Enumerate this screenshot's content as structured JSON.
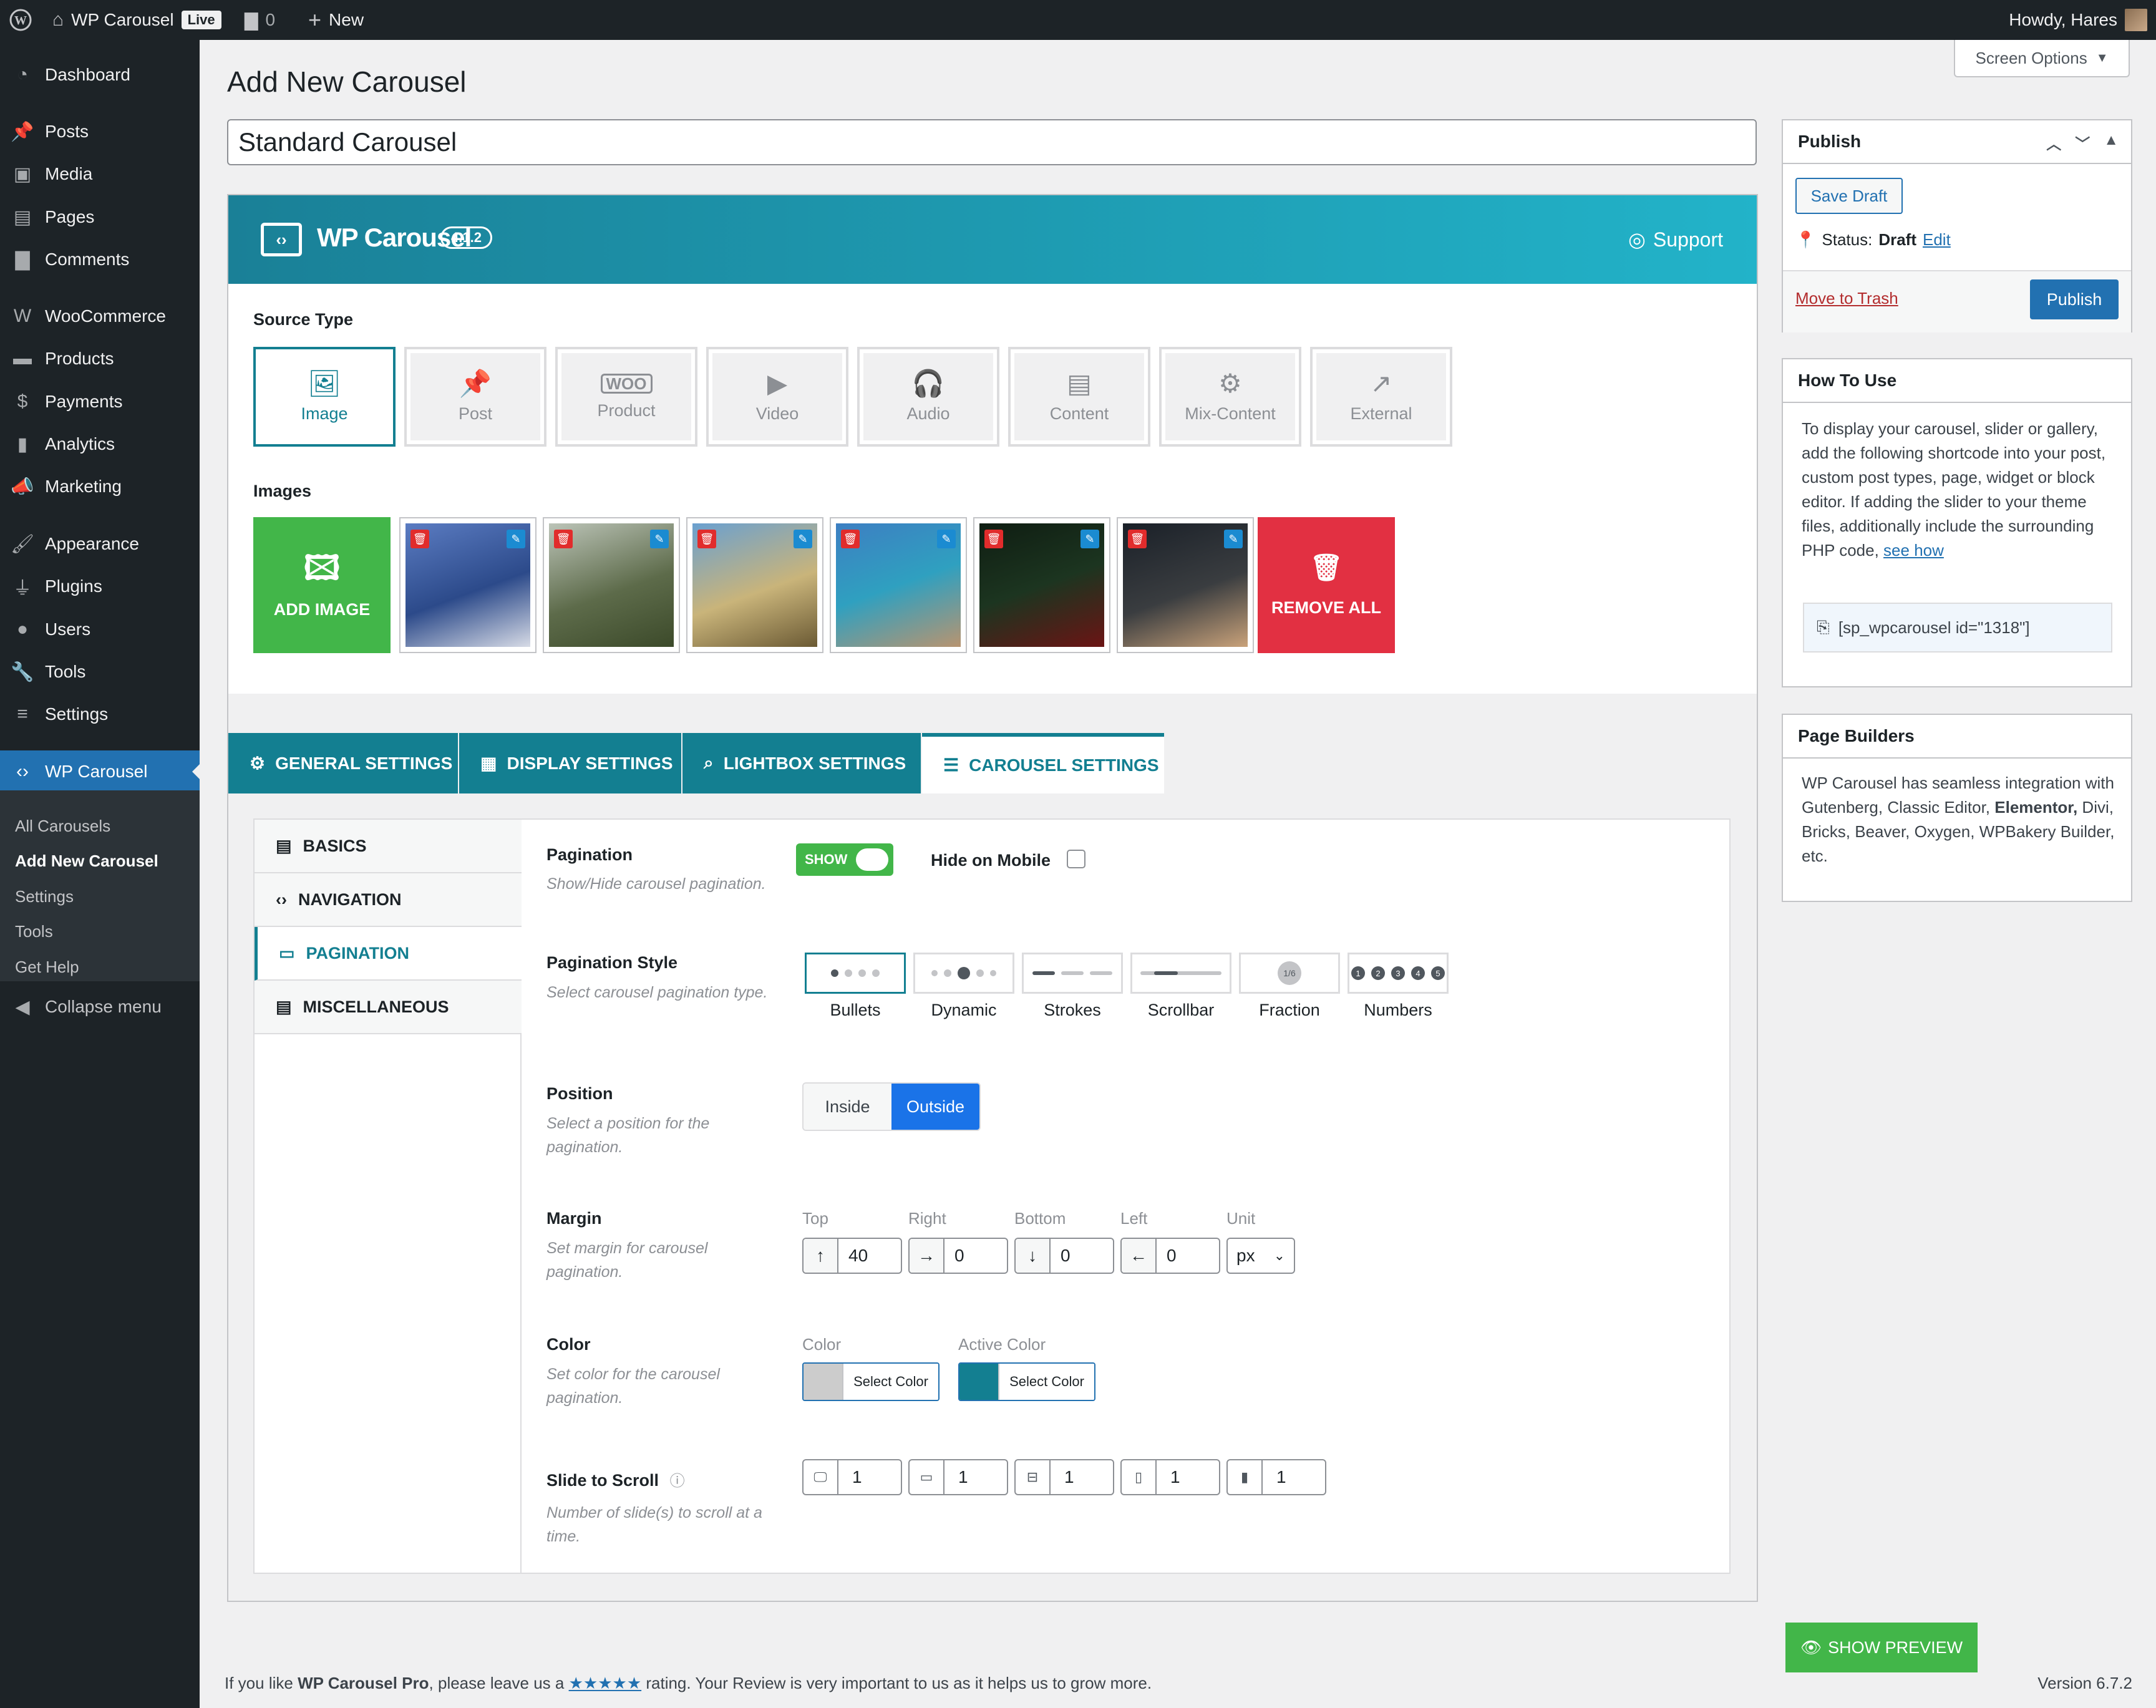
{
  "adminbar": {
    "site": "WP Carousel",
    "live": "Live",
    "comments": "0",
    "new": "New",
    "howdy": "Howdy, Hares"
  },
  "sidebar": {
    "items": [
      {
        "label": "Dashboard",
        "icon": "dashboard-icon"
      },
      {
        "label": "Posts",
        "icon": "pin-icon"
      },
      {
        "label": "Media",
        "icon": "media-icon"
      },
      {
        "label": "Pages",
        "icon": "pages-icon"
      },
      {
        "label": "Comments",
        "icon": "comment-icon"
      },
      {
        "label": "WooCommerce",
        "icon": "woo-icon"
      },
      {
        "label": "Products",
        "icon": "archive-icon"
      },
      {
        "label": "Payments",
        "icon": "dollar-icon"
      },
      {
        "label": "Analytics",
        "icon": "bar-chart-icon"
      },
      {
        "label": "Marketing",
        "icon": "megaphone-icon"
      },
      {
        "label": "Appearance",
        "icon": "brush-icon"
      },
      {
        "label": "Plugins",
        "icon": "plug-icon"
      },
      {
        "label": "Users",
        "icon": "user-icon"
      },
      {
        "label": "Tools",
        "icon": "wrench-icon"
      },
      {
        "label": "Settings",
        "icon": "sliders-icon"
      },
      {
        "label": "WP Carousel",
        "icon": "carousel-icon"
      }
    ],
    "submenu": [
      "All Carousels",
      "Add New Carousel",
      "Settings",
      "Tools",
      "Get Help"
    ],
    "collapse": "Collapse menu"
  },
  "page": {
    "title": "Add New Carousel",
    "screen_options": "Screen Options",
    "post_title": "Standard Carousel"
  },
  "plugin": {
    "name": "WP Carousel",
    "version": "4.1.2",
    "support": "Support"
  },
  "source": {
    "label": "Source Type",
    "types": [
      "Image",
      "Post",
      "Product",
      "Video",
      "Audio",
      "Content",
      "Mix-Content",
      "External"
    ],
    "selected": "Image"
  },
  "images": {
    "label": "Images",
    "add": "ADD IMAGE",
    "remove_all": "REMOVE ALL"
  },
  "tabs": [
    "GENERAL SETTINGS",
    "DISPLAY SETTINGS",
    "LIGHTBOX SETTINGS",
    "CAROUSEL SETTINGS"
  ],
  "subnav": [
    "BASICS",
    "NAVIGATION",
    "PAGINATION",
    "MISCELLANEOUS"
  ],
  "fields": {
    "pagination": {
      "label": "Pagination",
      "desc": "Show/Hide carousel pagination.",
      "toggle": "SHOW",
      "hide_mobile": "Hide on Mobile"
    },
    "style": {
      "label": "Pagination Style",
      "desc": "Select carousel pagination type.",
      "options": [
        "Bullets",
        "Dynamic",
        "Strokes",
        "Scrollbar",
        "Fraction",
        "Numbers"
      ],
      "fraction_text": "1/6"
    },
    "position": {
      "label": "Position",
      "desc": "Select a position for the pagination.",
      "options": [
        "Inside",
        "Outside"
      ],
      "selected": "Outside"
    },
    "margin": {
      "label": "Margin",
      "desc": "Set margin for carousel pagination.",
      "top_label": "Top",
      "right_label": "Right",
      "bottom_label": "Bottom",
      "left_label": "Left",
      "unit_label": "Unit",
      "top": "40",
      "right": "0",
      "bottom": "0",
      "left": "0",
      "unit": "px"
    },
    "color": {
      "label": "Color",
      "desc": "Set color for the carousel pagination.",
      "color_label": "Color",
      "active_label": "Active Color",
      "select": "Select Color",
      "color_value": "#cccccc",
      "active_value": "#137f91"
    },
    "scroll": {
      "label": "Slide to Scroll",
      "desc": "Number of slide(s) to scroll at a time.",
      "values": [
        "1",
        "1",
        "1",
        "1",
        "1"
      ]
    }
  },
  "publish": {
    "title": "Publish",
    "save_draft": "Save Draft",
    "status_label": "Status:",
    "status": "Draft",
    "edit": "Edit",
    "trash": "Move to Trash",
    "publish": "Publish"
  },
  "howto": {
    "title": "How To Use",
    "text": "To display your carousel, slider or gallery, add the following shortcode into your post, custom post types, page, widget or block editor. If adding the slider to your theme files, additionally include the surrounding PHP code, ",
    "link": "see how",
    "shortcode": "[sp_wpcarousel id=\"1318\"]"
  },
  "builders": {
    "title": "Page Builders",
    "pre": "WP Carousel has seamless integration with Gutenberg, Classic Editor, ",
    "bold": "Elementor,",
    "post": " Divi, Bricks, Beaver, Oxygen, WPBakery Builder, etc."
  },
  "footer": {
    "pre": "If you like ",
    "brand": "WP Carousel Pro",
    "mid": ", please leave us a ",
    "stars": "★★★★★",
    "post": " rating. Your Review is very important to us as it helps us to grow more.",
    "version": "Version 6.7.2",
    "preview": "SHOW PREVIEW"
  }
}
